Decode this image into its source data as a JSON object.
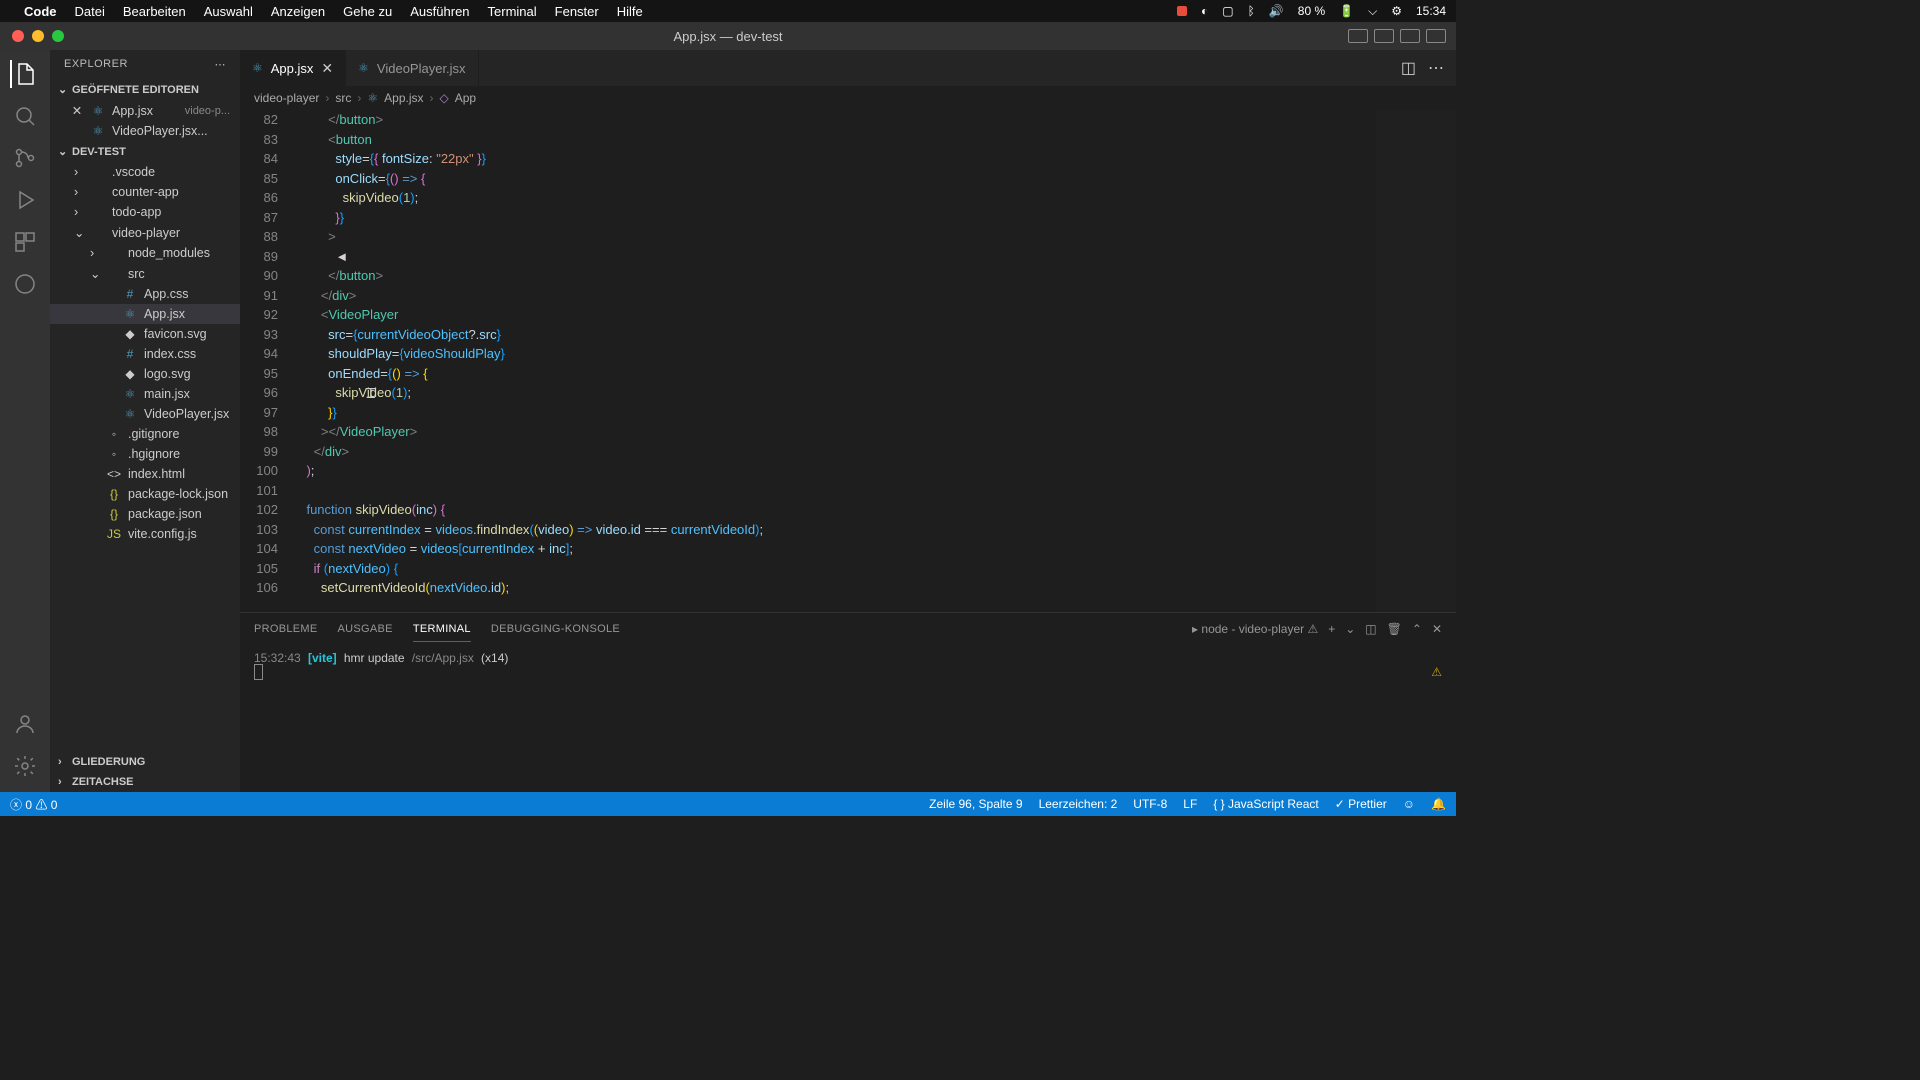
{
  "menubar": {
    "app": "Code",
    "items": [
      "Datei",
      "Bearbeiten",
      "Auswahl",
      "Anzeigen",
      "Gehe zu",
      "Ausführen",
      "Terminal",
      "Fenster",
      "Hilfe"
    ],
    "battery": "80 %",
    "time": "15:34"
  },
  "window": {
    "title": "App.jsx — dev-test"
  },
  "explorer": {
    "title": "EXPLORER",
    "openEditors": "GEÖFFNETE EDITOREN",
    "project": "DEV-TEST",
    "outline": "GLIEDERUNG",
    "timeline": "ZEITACHSE",
    "editors": [
      {
        "name": "App.jsx",
        "detail": "video-p...",
        "close": true
      },
      {
        "name": "VideoPlayer.jsx...",
        "detail": "",
        "close": false
      }
    ],
    "tree": [
      {
        "name": ".vscode",
        "type": "folder",
        "depth": 1,
        "expanded": false
      },
      {
        "name": "counter-app",
        "type": "folder",
        "depth": 1,
        "expanded": false
      },
      {
        "name": "todo-app",
        "type": "folder",
        "depth": 1,
        "expanded": false
      },
      {
        "name": "video-player",
        "type": "folder",
        "depth": 1,
        "expanded": true
      },
      {
        "name": "node_modules",
        "type": "folder",
        "depth": 2,
        "expanded": false
      },
      {
        "name": "src",
        "type": "folder",
        "depth": 2,
        "expanded": true
      },
      {
        "name": "App.css",
        "type": "css",
        "depth": 3
      },
      {
        "name": "App.jsx",
        "type": "react",
        "depth": 3,
        "active": true
      },
      {
        "name": "favicon.svg",
        "type": "svg",
        "depth": 3
      },
      {
        "name": "index.css",
        "type": "css",
        "depth": 3
      },
      {
        "name": "logo.svg",
        "type": "svg",
        "depth": 3
      },
      {
        "name": "main.jsx",
        "type": "react",
        "depth": 3
      },
      {
        "name": "VideoPlayer.jsx",
        "type": "react",
        "depth": 3
      },
      {
        "name": ".gitignore",
        "type": "file",
        "depth": 2
      },
      {
        "name": ".hgignore",
        "type": "file",
        "depth": 2
      },
      {
        "name": "index.html",
        "type": "html",
        "depth": 2
      },
      {
        "name": "package-lock.json",
        "type": "json",
        "depth": 2
      },
      {
        "name": "package.json",
        "type": "json",
        "depth": 2
      },
      {
        "name": "vite.config.js",
        "type": "js",
        "depth": 2
      }
    ]
  },
  "tabs": [
    {
      "name": "App.jsx",
      "active": true,
      "close": true
    },
    {
      "name": "VideoPlayer.jsx",
      "active": false,
      "close": false
    }
  ],
  "breadcrumbs": [
    "video-player",
    "src",
    "App.jsx",
    "App"
  ],
  "code": {
    "startLine": 82,
    "lines": [
      {
        "n": 82,
        "html": "          <span class='c-tag'>&lt;/</span><span class='c-el'>button</span><span class='c-tag'>&gt;</span>"
      },
      {
        "n": 83,
        "html": "          <span class='c-tag'>&lt;</span><span class='c-el'>button</span>"
      },
      {
        "n": 84,
        "html": "            <span class='c-attr'>style</span>=<span class='c-brace2'>{</span><span class='c-brace'>{</span> <span class='c-attr'>fontSize</span>: <span class='c-str'>\"22px\"</span> <span class='c-brace'>}</span><span class='c-brace2'>}</span>"
      },
      {
        "n": 85,
        "html": "            <span class='c-attr'>onClick</span>=<span class='c-brace2'>{</span><span class='c-brace'>(</span><span class='c-brace'>)</span> <span class='c-kw2'>=&gt;</span> <span class='c-brace'>{</span>"
      },
      {
        "n": 86,
        "html": "              <span class='c-fn'>skipVideo</span><span class='c-brace2'>(</span><span class='c-num'>1</span><span class='c-brace2'>)</span>;"
      },
      {
        "n": 87,
        "html": "            <span class='c-brace'>}</span><span class='c-brace2'>}</span>"
      },
      {
        "n": 88,
        "html": "          <span class='c-tag'>&gt;</span>"
      },
      {
        "n": 89,
        "html": "            ◄"
      },
      {
        "n": 90,
        "html": "          <span class='c-tag'>&lt;/</span><span class='c-el'>button</span><span class='c-tag'>&gt;</span>"
      },
      {
        "n": 91,
        "html": "        <span class='c-tag'>&lt;/</span><span class='c-el'>div</span><span class='c-tag'>&gt;</span>"
      },
      {
        "n": 92,
        "html": "        <span class='c-tag'>&lt;</span><span class='c-el'>VideoPlayer</span>"
      },
      {
        "n": 93,
        "html": "          <span class='c-attr'>src</span>=<span class='c-brace2'>{</span><span class='c-var'>currentVideoObject</span>?.<span class='c-attr'>src</span><span class='c-brace2'>}</span>"
      },
      {
        "n": 94,
        "html": "          <span class='c-attr'>shouldPlay</span>=<span class='c-brace2'>{</span><span class='c-var'>videoShouldPlay</span><span class='c-brace2'>}</span>"
      },
      {
        "n": 95,
        "html": "          <span class='c-attr'>onEnded</span>=<span class='c-brace2'>{</span><span class='c-brace3'>(</span><span class='c-brace3'>)</span> <span class='c-kw2'>=&gt;</span> <span class='c-brace3'>{</span>"
      },
      {
        "n": 96,
        "html": "            <span class='c-fn'>skipVideo</span><span class='c-brace2'>(</span><span class='c-num'>1</span><span class='c-brace2'>)</span>;"
      },
      {
        "n": 97,
        "html": "          <span class='c-brace3'>}</span><span class='c-brace2'>}</span>"
      },
      {
        "n": 98,
        "html": "        <span class='c-tag'>&gt;&lt;/</span><span class='c-el'>VideoPlayer</span><span class='c-tag'>&gt;</span>"
      },
      {
        "n": 99,
        "html": "      <span class='c-tag'>&lt;/</span><span class='c-el'>div</span><span class='c-tag'>&gt;</span>"
      },
      {
        "n": 100,
        "html": "    <span class='c-brace'>)</span>;"
      },
      {
        "n": 101,
        "html": ""
      },
      {
        "n": 102,
        "html": "    <span class='c-kw2'>function</span> <span class='c-fn'>skipVideo</span><span class='c-brace'>(</span><span class='c-param'>inc</span><span class='c-brace'>)</span> <span class='c-brace'>{</span>"
      },
      {
        "n": 103,
        "html": "      <span class='c-kw2'>const</span> <span class='c-var'>currentIndex</span> = <span class='c-var'>videos</span>.<span class='c-fn'>findIndex</span><span class='c-brace2'>(</span><span class='c-brace3'>(</span><span class='c-param'>video</span><span class='c-brace3'>)</span> <span class='c-kw2'>=&gt;</span> <span class='c-param'>video</span>.<span class='c-attr'>id</span> === <span class='c-var'>currentVideoId</span><span class='c-brace2'>)</span>;"
      },
      {
        "n": 104,
        "html": "      <span class='c-kw2'>const</span> <span class='c-var'>nextVideo</span> = <span class='c-var'>videos</span><span class='c-brace2'>[</span><span class='c-var'>currentIndex</span> + <span class='c-param'>inc</span><span class='c-brace2'>]</span>;"
      },
      {
        "n": 105,
        "html": "      <span class='c-kw'>if</span> <span class='c-brace2'>(</span><span class='c-var'>nextVideo</span><span class='c-brace2'>)</span> <span class='c-brace2'>{</span>"
      },
      {
        "n": 106,
        "html": "        <span class='c-fn'>setCurrentVideoId</span><span class='c-brace3'>(</span><span class='c-var'>nextVideo</span>.<span class='c-attr'>id</span><span class='c-brace3'>)</span>;"
      }
    ]
  },
  "panel": {
    "tabs": [
      "PROBLEME",
      "AUSGABE",
      "TERMINAL",
      "DEBUGGING-KONSOLE"
    ],
    "activeTab": 2,
    "process": "node - video-player",
    "line": {
      "time": "15:32:43",
      "tag": "[vite]",
      "msg": "hmr update",
      "path": "/src/App.jsx",
      "count": "(x14)"
    }
  },
  "status": {
    "errors": "0",
    "warnings": "0",
    "pos": "Zeile 96, Spalte 9",
    "spaces": "Leerzeichen: 2",
    "enc": "UTF-8",
    "eol": "LF",
    "lang": "JavaScript React",
    "prettier": "Prettier"
  }
}
